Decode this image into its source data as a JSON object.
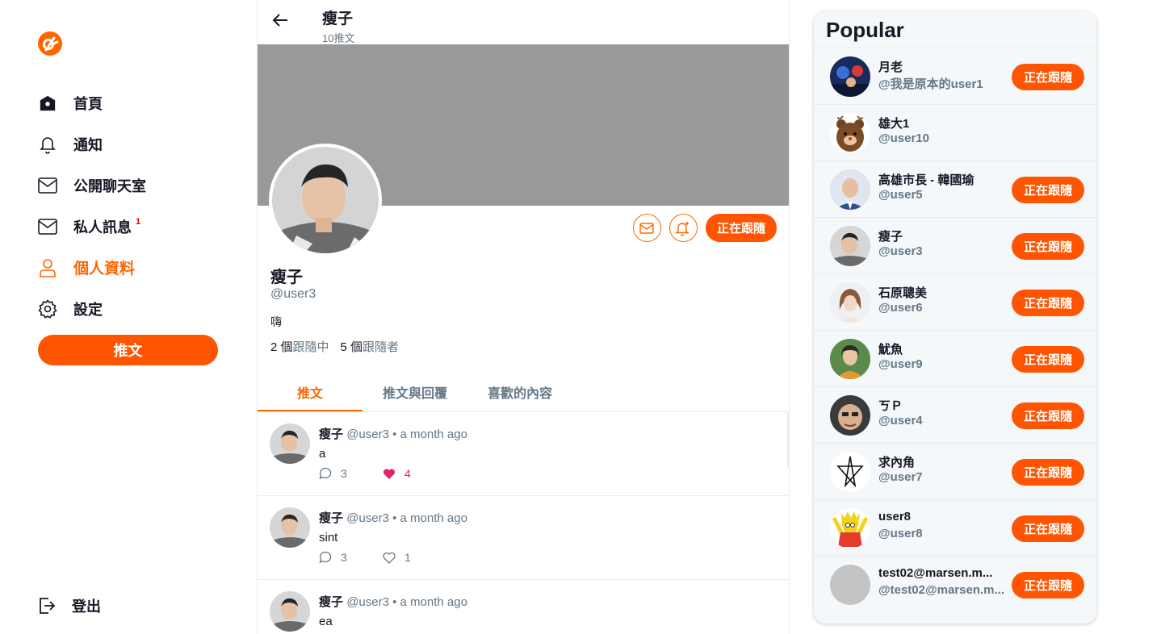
{
  "colors": {
    "brand": "#FF6600",
    "button": "#FF5500",
    "muted": "#657786",
    "like": "#E0245E",
    "cover": "#999999"
  },
  "sidebar": {
    "items": [
      {
        "label": "首頁",
        "icon": "home-icon"
      },
      {
        "label": "通知",
        "icon": "bell-icon"
      },
      {
        "label": "公開聊天室",
        "icon": "mail-icon"
      },
      {
        "label": "私人訊息",
        "icon": "mail-icon",
        "badge": "1"
      },
      {
        "label": "個人資料",
        "icon": "user-icon",
        "active": true
      },
      {
        "label": "設定",
        "icon": "gear-icon"
      }
    ],
    "tweet_button": "推文",
    "logout": "登出"
  },
  "header": {
    "name": "瘦子",
    "tweet_count": "10推文"
  },
  "profile": {
    "name": "瘦子",
    "handle": "@user3",
    "bio": "嗨",
    "following_count": "2 個",
    "following_label": "跟隨中",
    "followers_count": "5 個",
    "followers_label": "跟隨者",
    "follow_button": "正在跟隨"
  },
  "tabs": [
    "推文",
    "推文與回覆",
    "喜歡的內容"
  ],
  "tweets": [
    {
      "name": "瘦子",
      "handle": "@user3",
      "dot": "•",
      "time": "a month ago",
      "text": "a",
      "replies": "3",
      "likes": "4",
      "liked": true
    },
    {
      "name": "瘦子",
      "handle": "@user3",
      "dot": "•",
      "time": "a month ago",
      "text": "sint",
      "replies": "3",
      "likes": "1",
      "liked": false
    },
    {
      "name": "瘦子",
      "handle": "@user3",
      "dot": "•",
      "time": "a month ago",
      "text": "ea",
      "replies": "",
      "likes": "",
      "liked": false
    }
  ],
  "popular": {
    "title": "Popular",
    "button_label": "正在跟隨",
    "users": [
      {
        "name": "月老",
        "handle": "@我是原本的user1",
        "following": true
      },
      {
        "name": "雄大1",
        "handle": "@user10",
        "following": false
      },
      {
        "name": "高雄市長 - 韓國瑜",
        "handle": "@user5",
        "following": true
      },
      {
        "name": "瘦子",
        "handle": "@user3",
        "following": true
      },
      {
        "name": "石原聰美",
        "handle": "@user6",
        "following": true
      },
      {
        "name": "魷魚",
        "handle": "@user9",
        "following": true
      },
      {
        "name": "ㄎＰ",
        "handle": "@user4",
        "following": true
      },
      {
        "name": "求內角",
        "handle": "@user7",
        "following": true
      },
      {
        "name": "user8",
        "handle": "@user8",
        "following": true
      },
      {
        "name": "test02@marsen.m...",
        "handle": "@test02@marsen.m...",
        "following": true
      }
    ]
  }
}
